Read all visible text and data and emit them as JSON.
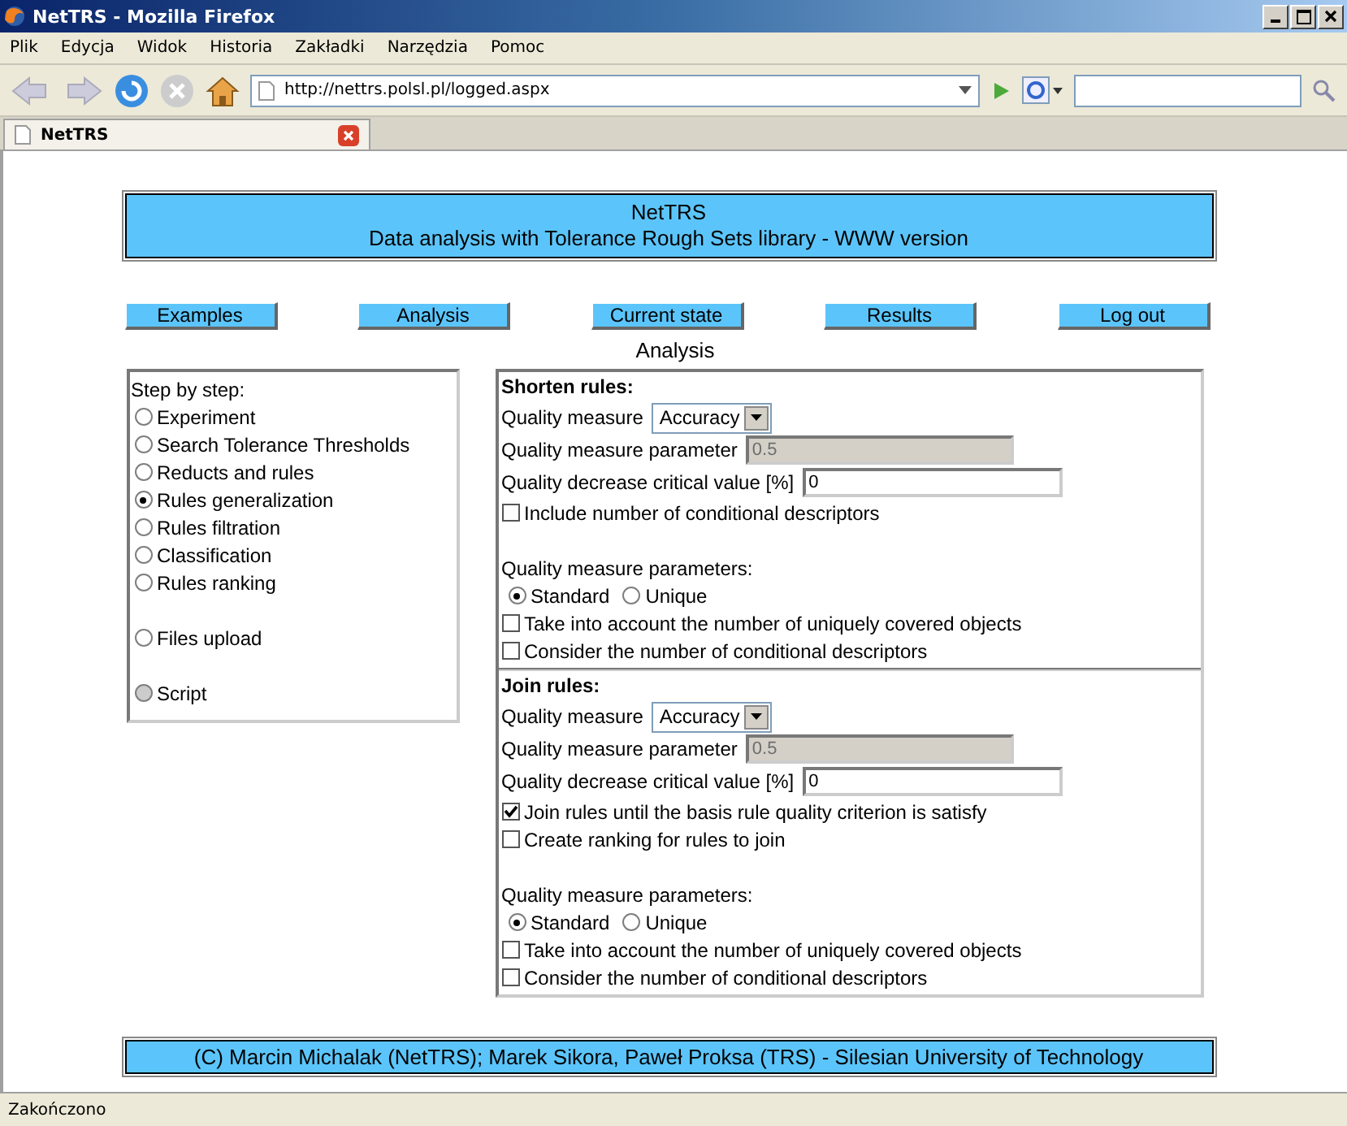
{
  "window": {
    "title": "NetTRS - Mozilla Firefox"
  },
  "menu": [
    "Plik",
    "Edycja",
    "Widok",
    "Historia",
    "Zakładki",
    "Narzędzia",
    "Pomoc"
  ],
  "address": {
    "value": "http://nettrs.polsl.pl/logged.aspx"
  },
  "tabs": [
    {
      "label": "NetTRS",
      "selected": true
    }
  ],
  "page": {
    "header": {
      "title": "NetTRS",
      "subtitle": "Data analysis with Tolerance Rough Sets library - WWW version"
    },
    "nav": [
      "Examples",
      "Analysis",
      "Current state",
      "Results",
      "Log out"
    ],
    "heading": "Analysis",
    "steps": {
      "title": "Step by step:",
      "groups": [
        [
          {
            "label": "Experiment",
            "selected": false,
            "disabled": false
          },
          {
            "label": "Search Tolerance Thresholds",
            "selected": false,
            "disabled": false
          },
          {
            "label": "Reducts and rules",
            "selected": false,
            "disabled": false
          },
          {
            "label": "Rules generalization",
            "selected": true,
            "disabled": false
          },
          {
            "label": "Rules filtration",
            "selected": false,
            "disabled": false
          },
          {
            "label": "Classification",
            "selected": false,
            "disabled": false
          },
          {
            "label": "Rules ranking",
            "selected": false,
            "disabled": false
          }
        ],
        [
          {
            "label": "Files upload",
            "selected": false,
            "disabled": false
          }
        ],
        [
          {
            "label": "Script",
            "selected": false,
            "disabled": true
          }
        ]
      ]
    },
    "sections": [
      {
        "title": "Shorten rules:",
        "measure": {
          "label": "Quality measure",
          "value": "Accuracy"
        },
        "parameter": {
          "label": "Quality measure parameter",
          "value": "0.5",
          "disabled": true
        },
        "critical": {
          "label": "Quality decrease critical value [%]",
          "value": "0"
        },
        "options": [
          {
            "label": "Include number of conditional descriptors",
            "checked": false
          }
        ],
        "params_label": "Quality measure parameters:",
        "radios": [
          {
            "label": "Standard",
            "selected": true
          },
          {
            "label": "Unique",
            "selected": false
          }
        ],
        "extra_options": [
          {
            "label": "Take into account the number of uniquely covered objects",
            "checked": false
          },
          {
            "label": "Consider the number of conditional descriptors",
            "checked": false
          }
        ]
      },
      {
        "title": "Join rules:",
        "measure": {
          "label": "Quality measure",
          "value": "Accuracy"
        },
        "parameter": {
          "label": "Quality measure parameter",
          "value": "0.5",
          "disabled": true
        },
        "critical": {
          "label": "Quality decrease critical value [%]",
          "value": "0"
        },
        "options": [
          {
            "label": "Join rules until the basis rule quality criterion is satisfy",
            "checked": true
          },
          {
            "label": "Create ranking for rules to join",
            "checked": false
          }
        ],
        "params_label": "Quality measure parameters:",
        "radios": [
          {
            "label": "Standard",
            "selected": true
          },
          {
            "label": "Unique",
            "selected": false
          }
        ],
        "extra_options": [
          {
            "label": "Take into account the number of uniquely covered objects",
            "checked": false
          },
          {
            "label": "Consider the number of conditional descriptors",
            "checked": false
          }
        ]
      }
    ],
    "footer": "(C) Marcin Michalak (NetTRS); Marek Sikora, Paweł Proksa (TRS) - Silesian University of Technology"
  },
  "status_bar": "Zakończono"
}
